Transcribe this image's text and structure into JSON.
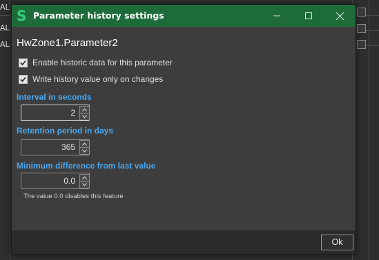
{
  "background": {
    "row_label": "AL"
  },
  "dialog": {
    "title": "Parameter history settings",
    "app_icon_letter": "S",
    "colors": {
      "titlebar": "#1e6b3a",
      "accent": "#4aa8f0",
      "icon": "#34d17a"
    },
    "heading": "HwZone1.Parameter2",
    "enable_historic": {
      "label": "Enable historic data for this parameter",
      "checked": true
    },
    "write_on_change": {
      "label": "Write history value only on changes",
      "checked": true
    },
    "interval": {
      "label": "Interval in seconds",
      "value": "2"
    },
    "retention": {
      "label": "Retention period in days",
      "value": "365"
    },
    "min_diff": {
      "label": "Minimum difference from last value",
      "value": "0.0"
    },
    "hint": "The value 0.0 disables this feature",
    "ok_label": "Ok"
  }
}
